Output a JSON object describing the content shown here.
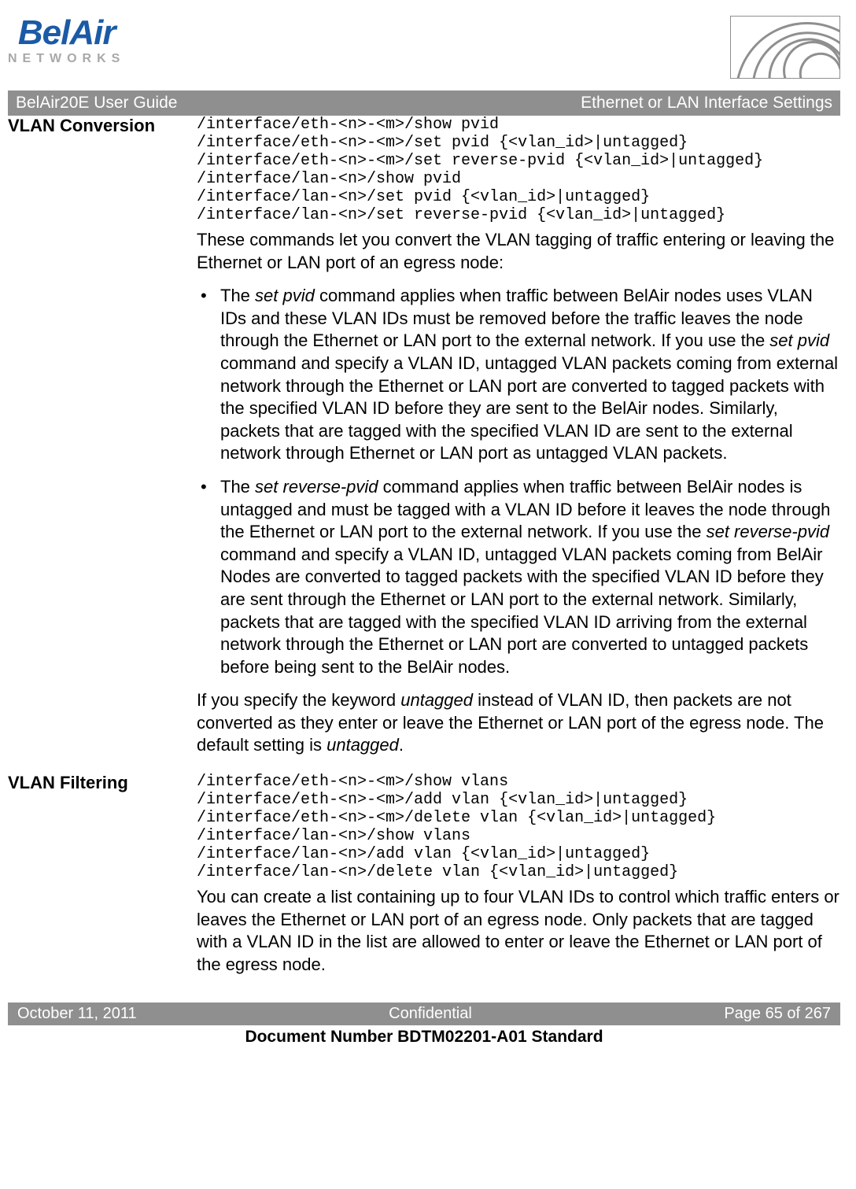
{
  "logo": {
    "brand": "BelAir",
    "sub": "NETWORKS"
  },
  "titlebar": {
    "left": "BelAir20E User Guide",
    "right": "Ethernet or LAN Interface Settings"
  },
  "sections": {
    "vlan_conversion": {
      "heading": "VLAN Conversion",
      "cmds": "/interface/eth-<n>-<m>/show pvid\n/interface/eth-<n>-<m>/set pvid {<vlan_id>|untagged}\n/interface/eth-<n>-<m>/set reverse-pvid {<vlan_id>|untagged}\n/interface/lan-<n>/show pvid\n/interface/lan-<n>/set pvid {<vlan_id>|untagged}\n/interface/lan-<n>/set reverse-pvid {<vlan_id>|untagged}",
      "intro": "These commands let you convert the VLAN tagging of traffic entering or leaving the Ethernet or LAN port of an egress node:",
      "bullet1_a": "The ",
      "bullet1_cmd1": "set pvid",
      "bullet1_b": " command applies when traffic between BelAir nodes uses VLAN IDs and these VLAN IDs must be removed before the traffic leaves the node through the Ethernet or LAN port to the external network. If you use the ",
      "bullet1_cmd2": "set pvid",
      "bullet1_c": " command and specify a VLAN ID, untagged VLAN packets coming from external network through the Ethernet or LAN port are converted to tagged packets with the specified VLAN ID before they are sent to the BelAir nodes. Similarly, packets that are tagged with the specified VLAN ID are sent to the external network through Ethernet or LAN port as untagged VLAN packets.",
      "bullet2_a": "The ",
      "bullet2_cmd1": "set reverse-pvid",
      "bullet2_b": " command applies when traffic between BelAir nodes is untagged and must be tagged with a VLAN ID before it leaves the node through the Ethernet or LAN port to the external network. If you use the ",
      "bullet2_cmd2": "set reverse-pvid",
      "bullet2_c": " command and specify a VLAN ID, untagged VLAN packets coming from BelAir Nodes are converted to tagged packets with the specified VLAN ID before they are sent through the Ethernet or LAN port to the external network. Similarly, packets that are tagged with the specified VLAN ID arriving from the external network through the Ethernet or LAN port are converted to untagged packets before being sent to the BelAir nodes.",
      "outro_a": "If you specify the keyword ",
      "outro_kw1": "untagged",
      "outro_b": " instead of VLAN ID, then packets are not converted as they enter or leave the Ethernet or LAN port of the egress node. The default setting is ",
      "outro_kw2": "untagged",
      "outro_c": "."
    },
    "vlan_filtering": {
      "heading": "VLAN Filtering",
      "cmds": "/interface/eth-<n>-<m>/show vlans\n/interface/eth-<n>-<m>/add vlan {<vlan_id>|untagged}\n/interface/eth-<n>-<m>/delete vlan {<vlan_id>|untagged}\n/interface/lan-<n>/show vlans\n/interface/lan-<n>/add vlan {<vlan_id>|untagged}\n/interface/lan-<n>/delete vlan {<vlan_id>|untagged}",
      "para": "You can create a list containing up to four VLAN IDs to control which traffic enters or leaves the Ethernet or LAN port of an egress node. Only packets that are tagged with a VLAN ID in the list are allowed to enter or leave the Ethernet or LAN port of the egress node."
    }
  },
  "footer": {
    "date": "October 11, 2011",
    "conf": "Confidential",
    "page": "Page 65 of 267",
    "docnum": "Document Number BDTM02201-A01 Standard"
  }
}
